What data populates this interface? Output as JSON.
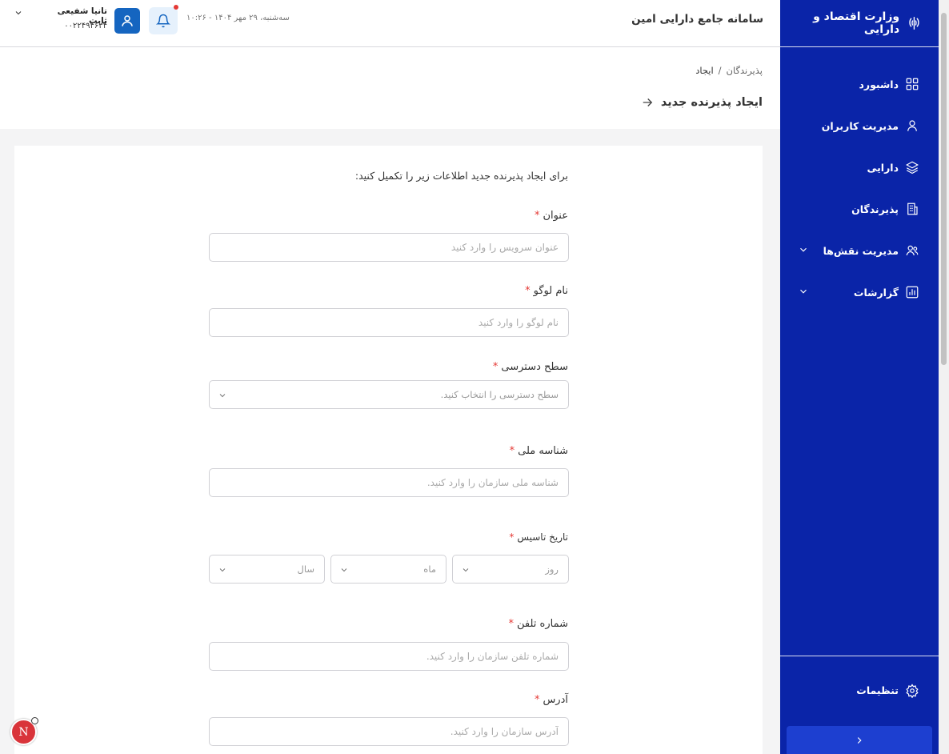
{
  "sidebar": {
    "brand": "وزارت اقتصاد و دارایی",
    "items": [
      {
        "label": "داشبورد",
        "icon": "grid-icon"
      },
      {
        "label": "مدیریت کاربران",
        "icon": "user-icon"
      },
      {
        "label": "دارایی",
        "icon": "layers-icon"
      },
      {
        "label": "پذیرندگان",
        "icon": "building-icon"
      },
      {
        "label": "مدیریت نقش‌ها",
        "icon": "users-icon"
      },
      {
        "label": "گزارشات",
        "icon": "chart-icon"
      }
    ],
    "settings_label": "تنظیمات"
  },
  "header": {
    "system_title": "سامانه جامع دارایی امین",
    "datetime": "سه‌شنبه، ۲۹ مهر ۱۴۰۴ - ۱۰:۲۶",
    "user_name": "تانیا شفیعی ثابت",
    "user_id": "۰۰۲۲۴۹۴۶۳۴"
  },
  "breadcrumb": {
    "parent": "پذیرندگان",
    "separator": "/",
    "current": "ایجاد"
  },
  "page_title": "ایجاد پذیرنده جدید",
  "form": {
    "intro": "برای ایجاد پذیرنده جدید اطلاعات زیر را تکمیل کنید:",
    "required_mark": "*",
    "title_label": "عنوان",
    "title_placeholder": "عنوان سرویس را وارد کنید",
    "logo_label": "نام لوگو",
    "logo_placeholder": "نام لوگو را وارد کنید",
    "access_label": "سطح دسترسی",
    "access_placeholder": "سطح دسترسی را انتخاب کنید.",
    "national_id_label": "شناسه ملی",
    "national_id_placeholder": "شناسه ملی سازمان را وارد کنید.",
    "founded_label": "تاریخ تاسیس",
    "day_placeholder": "روز",
    "month_placeholder": "ماه",
    "year_placeholder": "سال",
    "phone_label": "شماره تلفن",
    "phone_placeholder": "شماره تلفن سازمان را وارد کنید.",
    "address_label": "آدرس",
    "address_placeholder": "آدرس سازمان را وارد کنید."
  },
  "fab": {
    "letter": "N"
  }
}
